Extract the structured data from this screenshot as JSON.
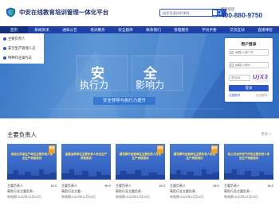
{
  "header": {
    "title": "中安在线教育培训管理一体化平台",
    "search_placeholder": "搜索您要找的课程...",
    "hotline_label": "客服电话",
    "hotline_number": "400-880-9750"
  },
  "nav": {
    "items": [
      "首页",
      "新闻资讯",
      "通知公告",
      "培训服务",
      "安全题库",
      "联系我们",
      "管理服务",
      "学员手册",
      "交流互动",
      "直播课程"
    ],
    "active_index": 0
  },
  "side_menu": {
    "items": [
      "主要负责人",
      "安全生产管理人员",
      "特种作业操作证"
    ]
  },
  "banner": {
    "char_left": "安",
    "char_right": "全",
    "sub_left": "执行力",
    "sub_right": "影响力",
    "slogan": "安全领导与执行力提升"
  },
  "login": {
    "title": "用户登录",
    "username_placeholder": "请输入用户名",
    "password_placeholder": "请输入密码",
    "captcha_placeholder": "验证码",
    "captcha_text": "UjX3",
    "button_label": "登录",
    "register_label": "注册账号",
    "forgot_label": "忘记密码?"
  },
  "section": {
    "title": "主要负责人",
    "more_label": "更多 >"
  },
  "cards": [
    {
      "tag": "初训",
      "image_title": "危险化学品生产单位主要负责人安全生产资格培训",
      "row_a_label": "主要负责人",
      "row_a_value": "16.0",
      "row_b_label": "高危行业主要负责...",
      "row_b_value": "",
      "row_c": "有效期:2022年12月02日"
    },
    {
      "tag": "",
      "image_title": "金属冶炼单位主要负责人安全生产资格培训",
      "row_a_label": "主要负责人",
      "row_a_value": "96.0",
      "row_b_label": "高危行业主要...",
      "row_b_value": "",
      "row_c": "有效期:2022年12月02日"
    },
    {
      "tag": "初训",
      "image_title": "烟花爆竹经营单位主要负责人安全生产资格培训",
      "row_a_label": "主要负责人",
      "row_a_value": "16.0",
      "row_b_label": "高危行业主要负责...",
      "row_b_value": "",
      "row_c": "有效期:2022年12月02日"
    },
    {
      "tag": "初训",
      "image_title": "烟花爆竹经营单位主要负责人安全生产资格培训",
      "row_a_label": "主要负责人",
      "row_a_value": "48.0",
      "row_b_label": "高危行业主要负责...",
      "row_b_value": "",
      "row_c": "有效期:2022年12月02日"
    },
    {
      "tag": "",
      "image_title": "陆上石油天然气开采主要负责人安全生产资格培训",
      "row_a_label": "主要负责人",
      "row_a_value": "16.0",
      "row_b_label": "高危行业主要负责...",
      "row_b_value": "",
      "row_c": "有效期:2022年12月02日"
    }
  ],
  "colors": {
    "brand_blue": "#1e41a8",
    "accent_blue": "#2a55c9",
    "tag_orange": "#f0a21f",
    "hotline_blue": "#1d3ea0"
  },
  "icons": [
    "shield-logo-icon",
    "search-icon",
    "phone-icon",
    "user-icon",
    "lock-icon"
  ]
}
